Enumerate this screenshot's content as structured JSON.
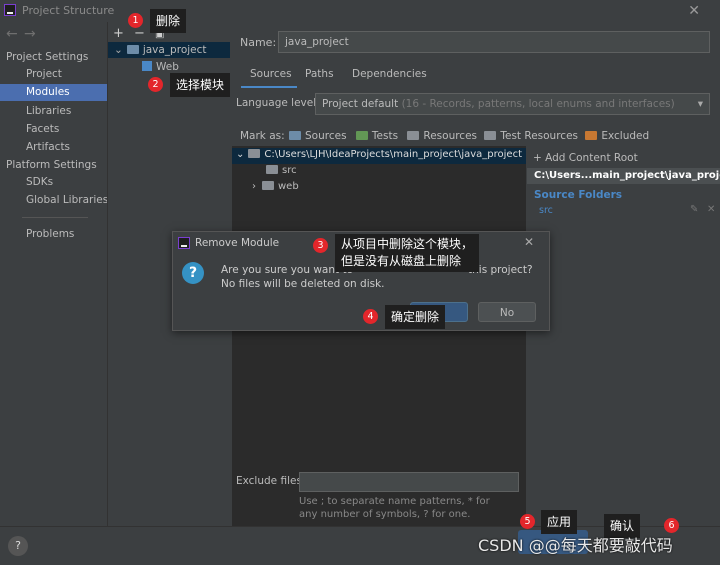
{
  "window": {
    "title": "Project Structure"
  },
  "sidebar": {
    "project_settings_header": "Project Settings",
    "project_items": [
      "Project",
      "Modules",
      "Libraries",
      "Facets",
      "Artifacts"
    ],
    "selected": "Modules",
    "platform_settings_header": "Platform Settings",
    "platform_items": [
      "SDKs",
      "Global Libraries"
    ],
    "problems": "Problems"
  },
  "module_tree": {
    "root": "java_project",
    "child": "Web"
  },
  "module_detail": {
    "name_label": "Name:",
    "name_value": "java_project",
    "tabs": [
      "Sources",
      "Paths",
      "Dependencies"
    ],
    "active_tab": "Sources",
    "language_level_label": "Language level:",
    "language_level_value": "Project default",
    "language_level_hint": "(16 - Records, patterns, local enums and interfaces)",
    "mark_as_label": "Mark as:",
    "mark_as_options": [
      "Sources",
      "Tests",
      "Resources",
      "Test Resources",
      "Excluded"
    ],
    "content_root_path": "C:\\Users\\LJH\\IdeaProjects\\main_project\\java_project",
    "folders": [
      "src",
      "web"
    ],
    "add_content_root": "Add Content Root",
    "content_root_short": "C:\\Users...main_project\\java_project",
    "source_folders_header": "Source Folders",
    "source_folder_item": "src",
    "exclude_files_label": "Exclude files:",
    "exclude_hint": "Use ; to separate name patterns, * for any number of symbols, ? for one."
  },
  "dialog": {
    "title": "Remove Module",
    "message_line1": "Are you sure you want to",
    "message_tail": "this project?",
    "message_line2": "No files will be deleted on disk.",
    "no_label": "No"
  },
  "annotations": {
    "c1": "删除",
    "c2": "选择模块",
    "c3_line1": "从项目中删除这个模块，",
    "c3_line2": "但是没有从磁盘上删除",
    "c4": "确定删除",
    "c5": "应用",
    "c6": "确认",
    "n1": "1",
    "n2": "2",
    "n3": "3",
    "n4": "4",
    "n5": "5",
    "n6": "6"
  },
  "footer": {
    "help": "?",
    "watermark": "CSDN @@每天都要敲代码"
  },
  "colors": {
    "background": "#3c3f41",
    "selection": "#4b6eaf",
    "accent": "#365880",
    "badge": "#e3262b"
  }
}
